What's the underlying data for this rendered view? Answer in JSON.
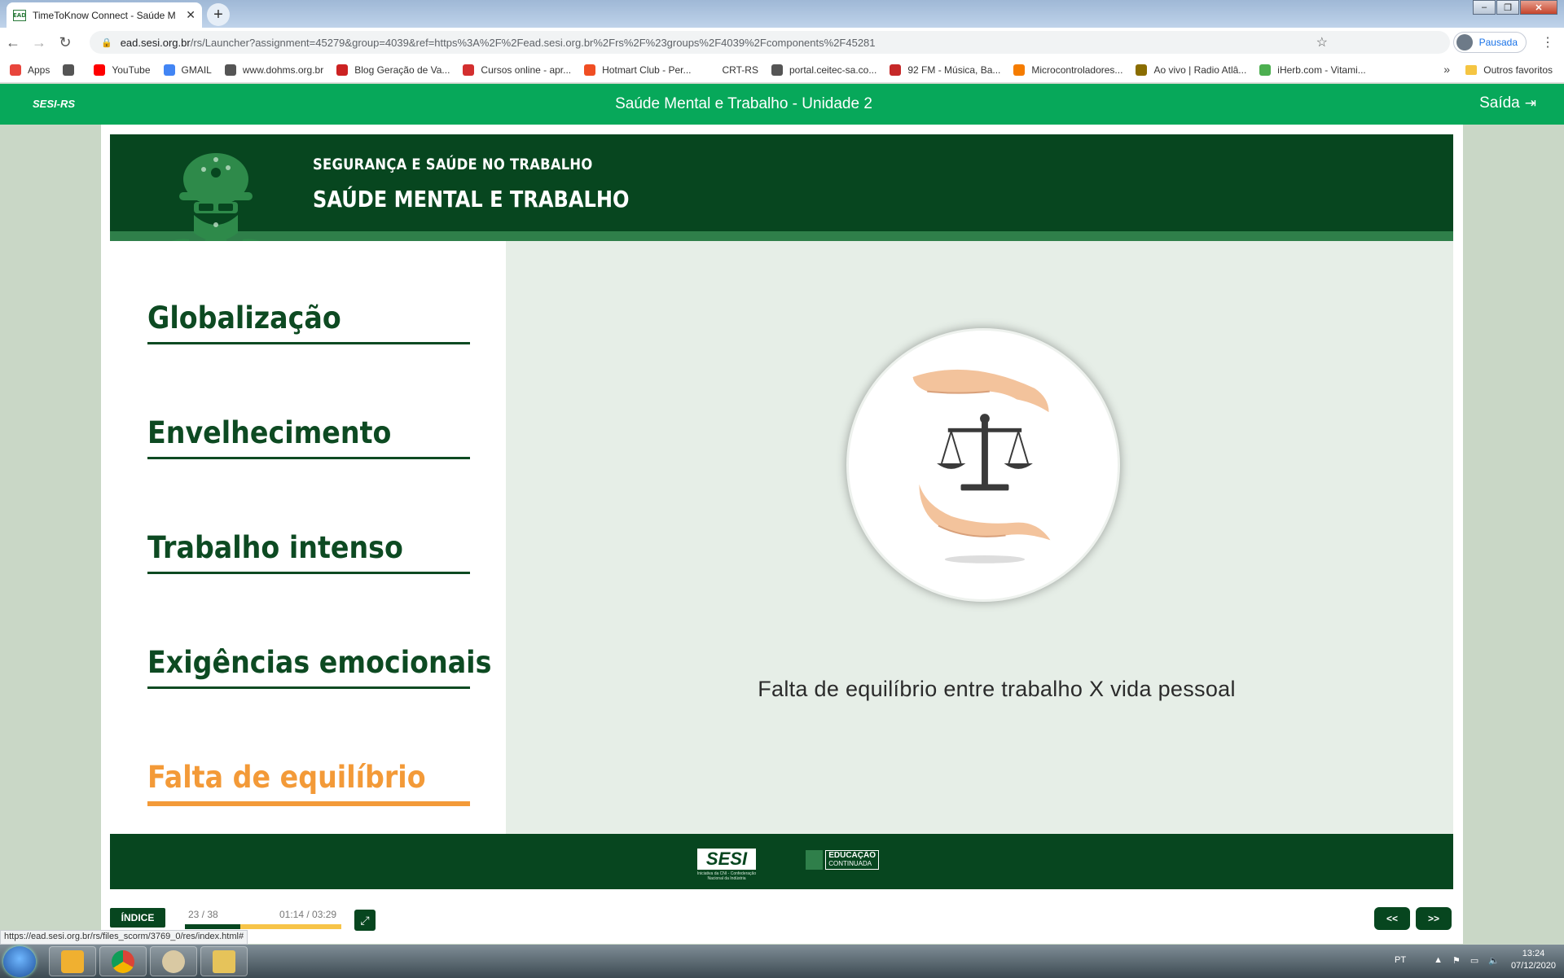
{
  "browser": {
    "tab_title": "TimeToKnow Connect - Saúde M",
    "tab_favicon_text": "EAD",
    "url_host": "ead.sesi.org.br",
    "url_path": "/rs/Launcher?assignment=45279&group=4039&ref=https%3A%2F%2Fead.sesi.org.br%2Frs%2F%23groups%2F4039%2Fcomponents%2F45281",
    "profile_label": "Pausada",
    "bookmarks": [
      {
        "label": "Apps",
        "icon": "apps-grid-icon",
        "color": "#e8453c"
      },
      {
        "label": "",
        "icon": "globe-icon",
        "color": "#555555"
      },
      {
        "label": "YouTube",
        "icon": "youtube-icon",
        "color": "#ff0000"
      },
      {
        "label": "GMAIL",
        "icon": "google-icon",
        "color": "#4285f4"
      },
      {
        "label": "www.dohms.org.br",
        "icon": "globe-icon",
        "color": "#555555"
      },
      {
        "label": "Blog Geração de Va...",
        "icon": "blog-icon",
        "color": "#cc2222"
      },
      {
        "label": "Cursos online - apr...",
        "icon": "cursos-icon",
        "color": "#d32f2f"
      },
      {
        "label": "Hotmart Club - Per...",
        "icon": "hotmart-icon",
        "color": "#f04e23"
      },
      {
        "label": "CRT-RS",
        "icon": "blank-icon",
        "color": "#ffffff"
      },
      {
        "label": "portal.ceitec-sa.co...",
        "icon": "globe-icon",
        "color": "#555555"
      },
      {
        "label": "92 FM - Música, Ba...",
        "icon": "radio-92-icon",
        "color": "#c62828"
      },
      {
        "label": "Microcontroladores...",
        "icon": "blogger-icon",
        "color": "#f57c00"
      },
      {
        "label": "Ao vivo | Radio Atlâ...",
        "icon": "radio-icon",
        "color": "#8a6d00"
      },
      {
        "label": "iHerb.com - Vitami...",
        "icon": "leaf-icon",
        "color": "#4caf50"
      }
    ],
    "bookmarks_more": "»",
    "other_bookmarks": "Outros favoritos",
    "status_url": "https://ead.sesi.org.br/rs/files_scorm/3769_0/res/index.html#"
  },
  "app_header": {
    "brand": "SESI-RS",
    "unit_title": "Saúde Mental e Trabalho - Unidade 2",
    "exit_label": "Saída"
  },
  "course": {
    "subtitle": "SEGURANÇA E SAÚDE NO TRABALHO",
    "title": "SAÚDE MENTAL E TRABALHO"
  },
  "topics": [
    {
      "label": "Globalização",
      "active": false
    },
    {
      "label": "Envelhecimento",
      "active": false
    },
    {
      "label": "Trabalho intenso",
      "active": false
    },
    {
      "label": "Exigências emocionais",
      "active": false
    },
    {
      "label": "Falta de equilíbrio",
      "active": true
    }
  ],
  "content": {
    "image_icon": "hands-holding-scale-icon",
    "caption": "Falta de equilíbrio entre trabalho X vida pessoal"
  },
  "footer": {
    "sesi_logo_text": "SESI",
    "sesi_tagline_1": "Iniciativa da CNI - Confederação",
    "sesi_tagline_2": "Nacional da Indústria",
    "edu_line_1": "EDUCAÇÃO",
    "edu_line_2": "CONTINUADA"
  },
  "player": {
    "index_label": "ÍNDICE",
    "page_counter": "23 / 38",
    "time_counter": "01:14 / 03:29",
    "progress_fraction": 0.354,
    "prev_label": "<<",
    "next_label": ">>"
  },
  "taskbar": {
    "lang": "PT",
    "time": "13:24",
    "date": "07/12/2020"
  },
  "colors": {
    "header_green": "#07a85a",
    "dark_green": "#07461f",
    "accent_orange": "#f39a38",
    "content_bg": "#e6eee7",
    "progress_yellow": "#f7c448"
  }
}
